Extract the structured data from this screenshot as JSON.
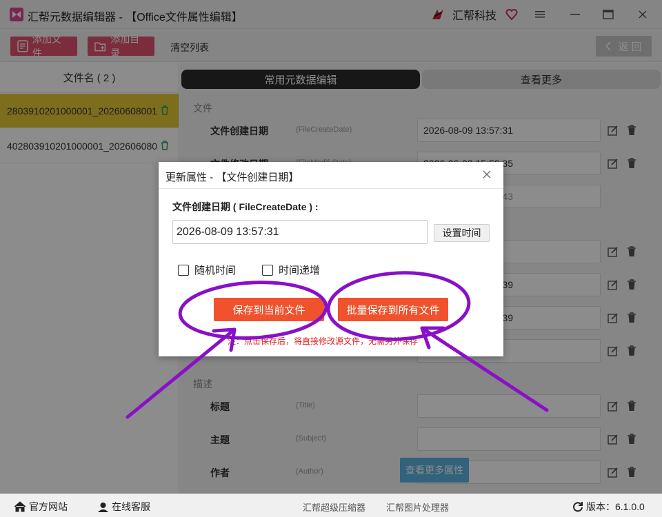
{
  "app": {
    "title": "汇帮元数据编辑器 - 【Office文件属性编辑】",
    "brand": "汇帮科技"
  },
  "toolbar": {
    "add_file": "添加文件",
    "add_dir": "添加目录",
    "clear_list": "清空列表",
    "back": "返 回"
  },
  "file_list": {
    "header": "文件名 ( 2 )",
    "items": [
      {
        "name": "2803910201000001_20260608001",
        "selected": true
      },
      {
        "name": "402803910201000001_202606080",
        "selected": false
      }
    ]
  },
  "tabs": {
    "active": "常用元数据编辑",
    "inactive": "查看更多"
  },
  "sections": {
    "file": "文件",
    "desc": "描述"
  },
  "properties": [
    {
      "label": "文件创建日期",
      "key": "(FileCreateDate)",
      "value": "2026-08-09 13:57:31"
    },
    {
      "label": "文件修改日期",
      "key": "(FileModifyDate)",
      "value": "2026-06-03 15:59:35"
    },
    {
      "label": "",
      "key": "",
      "value": "...43"
    },
    {
      "label": "",
      "key": "",
      "value": ""
    },
    {
      "label": "",
      "key": "",
      "value": "...39"
    },
    {
      "label": "",
      "key": "",
      "value": "...39"
    },
    {
      "label": "",
      "key": "",
      "value": ""
    }
  ],
  "desc_properties": [
    {
      "label": "标题",
      "key": "(Title)",
      "value": ""
    },
    {
      "label": "主题",
      "key": "(Subject)",
      "value": ""
    },
    {
      "label": "作者",
      "key": "(Author)",
      "value": ""
    }
  ],
  "more_props_button": "查看更多属性",
  "dialog": {
    "title": "更新属性 - 【文件创建日期】",
    "field_label": "文件创建日期 ( FileCreateDate ) :",
    "value": "2026-08-09 13:57:31",
    "set_time": "设置时间",
    "random_time": "随机时间",
    "increment_time": "时间递增",
    "save_current": "保存到当前文件",
    "save_all": "批量保存到所有文件",
    "note": "注：点击保存后，将直接修改源文件，无需另外保存"
  },
  "statusbar": {
    "website": "官方网站",
    "support": "在线客服",
    "compressor": "汇帮超级压缩器",
    "image_tool": "汇帮图片处理器",
    "version": "版本：6.1.0.0"
  },
  "colors": {
    "accent_pink": "#e05070",
    "selected_row": "#e3c836",
    "save_button": "#f0522d",
    "annotation": "#8a10c8",
    "more_button": "#5bb2e2"
  }
}
